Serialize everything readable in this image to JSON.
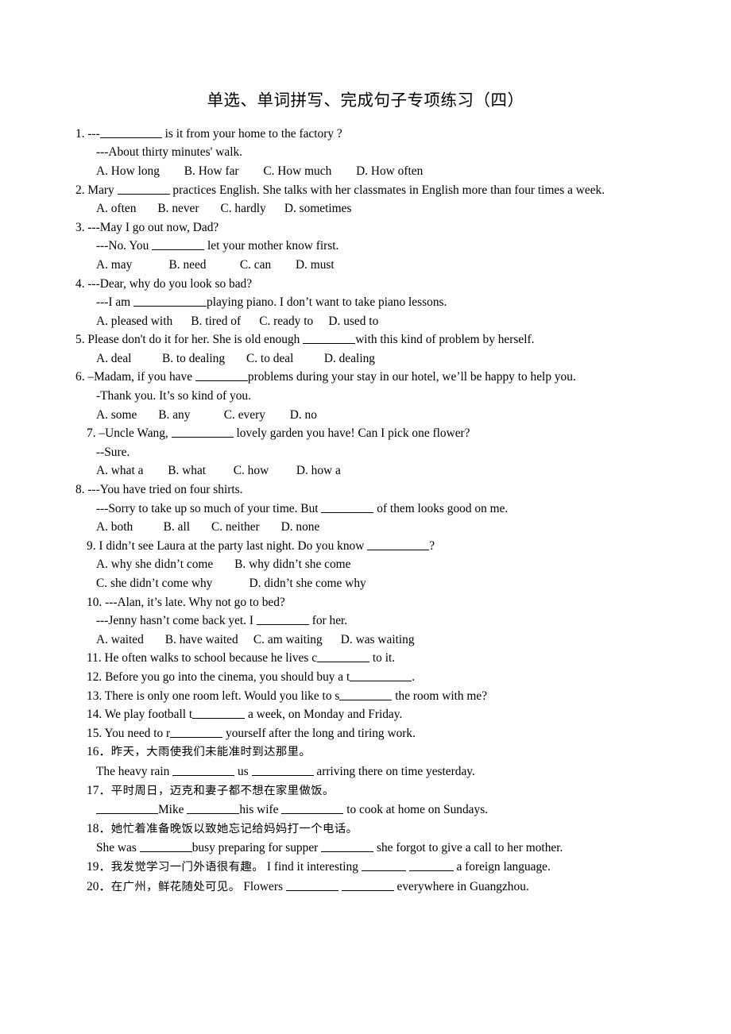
{
  "document": {
    "title": "单选、单词拼写、完成句子专项练习（四）",
    "questions": {
      "q1": {
        "stem_a": "1. ---",
        "stem_b": " is it from your home to the factory ?",
        "reply": "---About thirty minutes' walk.",
        "optA": "A. How long",
        "optB": "B. How far",
        "optC": "C. How much",
        "optD": "D. How often"
      },
      "q2": {
        "stem_a": "2. Mary ",
        "stem_b": " practices English. She talks with her classmates in English more than four times a week.",
        "optA": "A. often",
        "optB": "B. never",
        "optC": "C. hardly",
        "optD": "D. sometimes"
      },
      "q3": {
        "stem": "3. ---May I go out now, Dad?",
        "reply_a": "---No. You ",
        "reply_b": " let your mother know first.",
        "optA": "A. may",
        "optB": "B. need",
        "optC": "C. can",
        "optD": "D. must"
      },
      "q4": {
        "stem": "4. ---Dear, why do you look so bad?",
        "reply_a": "---I am ",
        "reply_b": "playing piano. I don’t want to take piano lessons.",
        "optA": "A. pleased with",
        "optB": "B. tired of",
        "optC": "C. ready to",
        "optD": "D. used to"
      },
      "q5": {
        "stem_a": "5. Please don't do it for her. She is old enough ",
        "stem_b": "with this kind of problem by herself.",
        "optA": "A. deal",
        "optB": "B. to dealing",
        "optC": "C. to deal",
        "optD": "D. dealing"
      },
      "q6": {
        "stem_a": "6. –Madam, if you have ",
        "stem_b": "problems during your stay in our hotel, we’ll be happy to help you.",
        "reply": "-Thank you. It’s so kind of you.",
        "optA": "A. some",
        "optB": "B. any",
        "optC": "C. every",
        "optD": "D. no"
      },
      "q7": {
        "stem_a": "7. –Uncle Wang, ",
        "stem_b": " lovely garden you have! Can I pick one flower?",
        "reply": "--Sure.",
        "optA": "A. what a",
        "optB": "B. what",
        "optC": "C. how",
        "optD": "D. how a"
      },
      "q8": {
        "stem": "8. ---You have tried on four shirts.",
        "reply_a": "---Sorry to take up so much of your time. But ",
        "reply_b": " of them looks good on me.",
        "optA": "A. both",
        "optB": "B. all",
        "optC": "C. neither",
        "optD": "D. none"
      },
      "q9": {
        "stem_a": "9. I didn’t see Laura at the party last night. Do you know ",
        "stem_b": "?",
        "optA": "A. why she didn’t come",
        "optB": "B. why didn’t she come",
        "optC": "C. she didn’t come why",
        "optD": "D. didn’t she come why"
      },
      "q10": {
        "stem": "10. ---Alan, it’s late. Why not go to bed?",
        "reply_a": "---Jenny hasn’t come back yet. I ",
        "reply_b": " for her.",
        "optA": "A. waited",
        "optB": "B. have waited",
        "optC": "C. am waiting",
        "optD": "D. was waiting"
      },
      "q11": {
        "stem_a": "11. He often walks to school because he lives c",
        "stem_b": " to it."
      },
      "q12": {
        "stem_a": "12. Before you go into the cinema, you should buy a t",
        "stem_b": "."
      },
      "q13": {
        "stem_a": "13. There is only one room left. Would you like to s",
        "stem_b": " the room with me?"
      },
      "q14": {
        "stem_a": "14. We play football t",
        "stem_b": " a week, on Monday and Friday."
      },
      "q15": {
        "stem_a": "15. You need to r",
        "stem_b": " yourself after the long and tiring work."
      },
      "q16": {
        "num": "16．",
        "cn": "昨天，大雨使我们未能准时到达那里。",
        "en_a": "The heavy rain ",
        "en_b": " us ",
        "en_c": " arriving there on time yesterday."
      },
      "q17": {
        "num": "17．",
        "cn": "平时周日，迈克和妻子都不想在家里做饭。",
        "en_a": "",
        "en_b": "Mike ",
        "en_c": "his wife ",
        "en_d": " to cook at home on Sundays."
      },
      "q18": {
        "num": "18．",
        "cn": "她忙着准备晚饭以致她忘记给妈妈打一个电话。",
        "en_a": "She was ",
        "en_b": "busy preparing for supper ",
        "en_c": " she forgot to give a call to her mother."
      },
      "q19": {
        "num": "19．",
        "cn": "我发觉学习一门外语很有趣。",
        "en_a": " I find it interesting ",
        "en_b": " ",
        "en_c": " a foreign language."
      },
      "q20": {
        "num": "20．",
        "cn": "在广州，鲜花随处可见。",
        "en_a": " Flowers ",
        "en_b": " ",
        "en_c": " everywhere in Guangzhou."
      }
    }
  }
}
